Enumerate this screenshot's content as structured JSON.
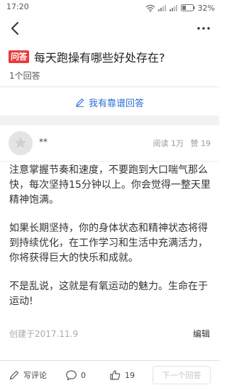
{
  "status_bar": {
    "time": "17:20",
    "battery": "32%"
  },
  "question": {
    "badge": "问答",
    "title": "每天跑操有哪些好处存在?",
    "answer_count": "1个回答"
  },
  "answer_button": {
    "label": "我有靠谱回答"
  },
  "answer": {
    "author": "**",
    "reads": "阅读 1万",
    "likes": "赞 19",
    "paragraphs": [
      "注意掌握节奏和速度，不要跑到大口喘气那么快，每次坚持15分钟以上。你会觉得一整天里精神饱满。",
      "如果长期坚持，你的身体状态和精神状态将得到持续优化，在工作学习和生活中充满活力，你将获得巨大的快乐和成就。",
      "不是乱说，这就是有氧运动的魅力。生命在于运动!"
    ],
    "created": "创建于2017.11.9",
    "edit": "编辑"
  },
  "bottom_bar": {
    "comment_label": "写评论",
    "comment_count": "0",
    "like_count": "19",
    "next_label": "下一个回答"
  }
}
